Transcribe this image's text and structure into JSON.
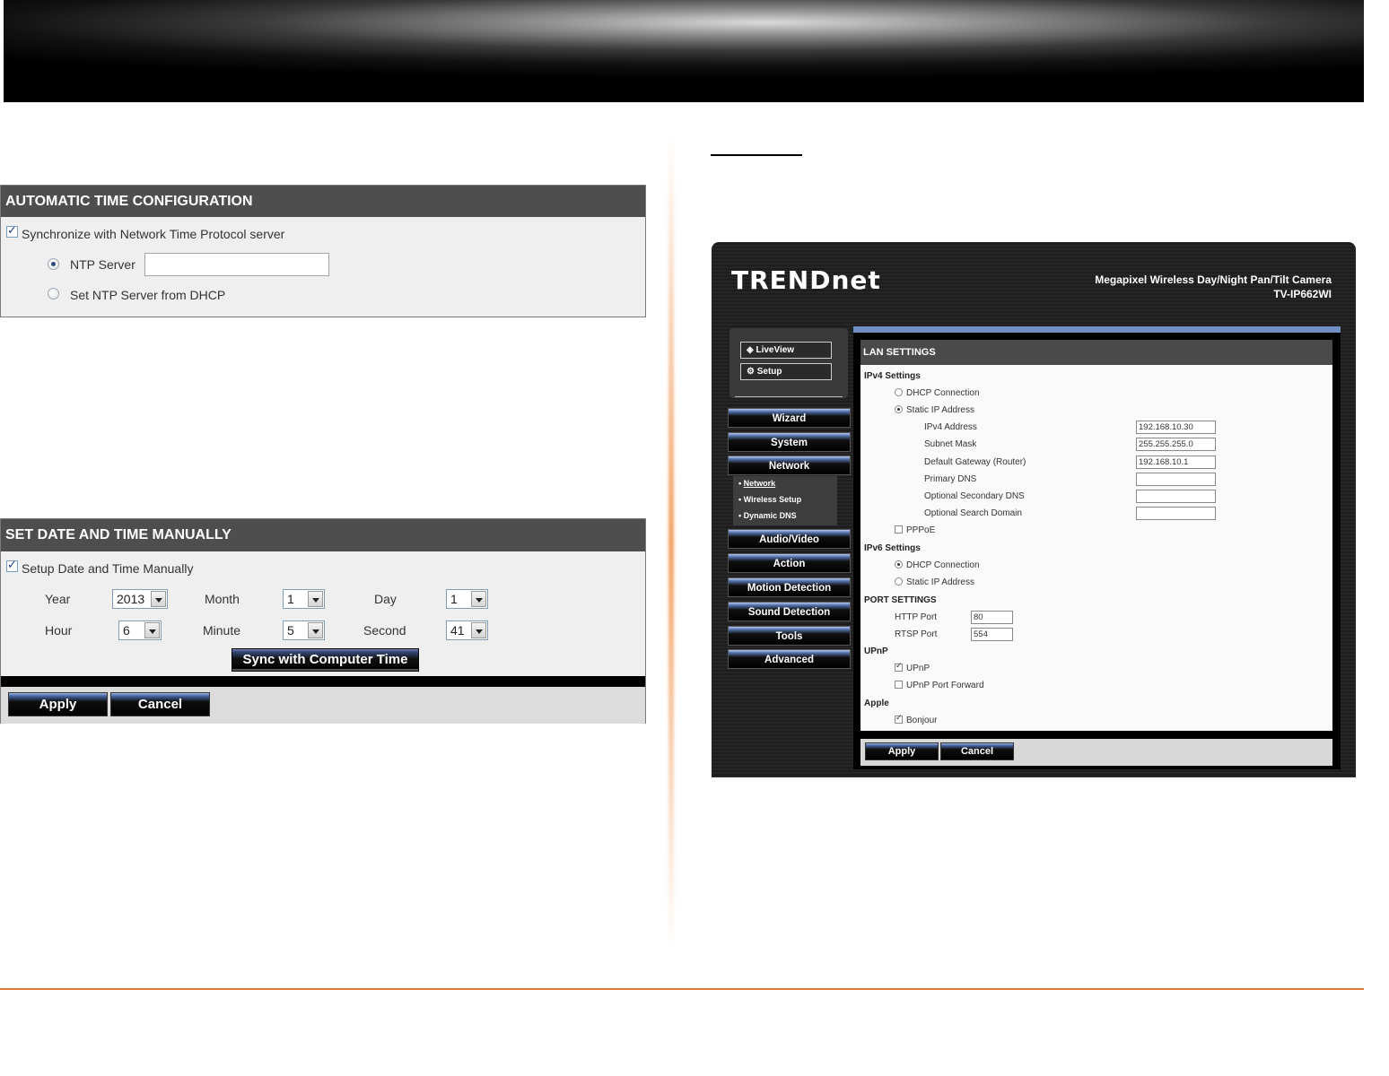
{
  "auto_time": {
    "title": "AUTOMATIC TIME CONFIGURATION",
    "sync_label": "Synchronize with Network Time Protocol server",
    "ntp_server_label": "NTP Server",
    "ntp_server_value": "",
    "dhcp_label": "Set NTP Server from DHCP"
  },
  "manual_time": {
    "title": "SET DATE AND TIME MANUALLY",
    "setup_label": "Setup Date and Time Manually",
    "year_label": "Year",
    "year_value": "2013",
    "month_label": "Month",
    "month_value": "1",
    "day_label": "Day",
    "day_value": "1",
    "hour_label": "Hour",
    "hour_value": "6",
    "minute_label": "Minute",
    "minute_value": "5",
    "second_label": "Second",
    "second_value": "41",
    "sync_button": "Sync with Computer Time",
    "apply_button": "Apply",
    "cancel_button": "Cancel"
  },
  "camera": {
    "logo": "TRENDnet",
    "product_line": "Megapixel Wireless Day/Night Pan/Tilt Camera",
    "model": "TV-IP662WI",
    "nav_top": {
      "liveview": "LiveView",
      "setup": "Setup"
    },
    "nav": {
      "wizard": "Wizard",
      "system": "System",
      "network": "Network",
      "sub_network": "Network",
      "sub_wireless": "Wireless Setup",
      "sub_ddns": "Dynamic DNS",
      "audio_video": "Audio/Video",
      "action": "Action",
      "motion": "Motion Detection",
      "sound": "Sound Detection",
      "tools": "Tools",
      "advanced": "Advanced"
    },
    "lan": {
      "title": "LAN SETTINGS",
      "ipv4_title": "IPv4 Settings",
      "dhcp": "DHCP Connection",
      "static": "Static IP Address",
      "ipv4_address_label": "IPv4 Address",
      "ipv4_address": "192.168.10.30",
      "subnet_label": "Subnet Mask",
      "subnet": "255.255.255.0",
      "gateway_label": "Default Gateway (Router)",
      "gateway": "192.168.10.1",
      "primary_dns_label": "Primary DNS",
      "primary_dns": "",
      "secondary_dns_label": "Optional Secondary DNS",
      "secondary_dns": "",
      "search_domain_label": "Optional Search Domain",
      "search_domain": "",
      "pppoe": "PPPoE",
      "ipv6_title": "IPv6 Settings",
      "ipv6_dhcp": "DHCP Connection",
      "ipv6_static": "Static IP Address",
      "port_title": "PORT SETTINGS",
      "http_label": "HTTP Port",
      "http": "80",
      "rtsp_label": "RTSP Port",
      "rtsp": "554",
      "upnp_title": "UPnP",
      "upnp": "UPnP",
      "upnp_forward": "UPnP Port Forward",
      "apple_title": "Apple",
      "bonjour": "Bonjour",
      "apply": "Apply",
      "cancel": "Cancel"
    }
  }
}
